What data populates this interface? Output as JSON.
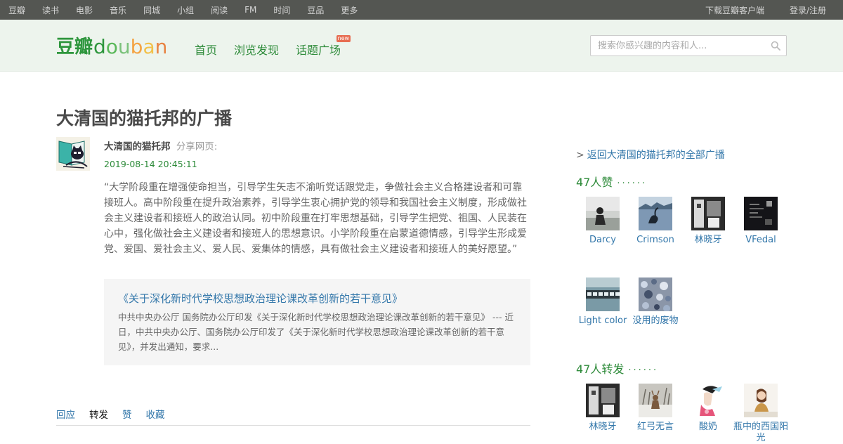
{
  "topbar": {
    "left_links": [
      "豆瓣",
      "读书",
      "电影",
      "音乐",
      "同城",
      "小组",
      "阅读",
      "FM",
      "时间",
      "豆品",
      "更多"
    ],
    "download": "下载豆瓣客户端",
    "login": "登录/注册"
  },
  "header": {
    "logo_cn": "豆瓣",
    "logo_en": "douban",
    "nav": [
      "首页",
      "浏览发现",
      "话题广场"
    ],
    "new_badge": "new",
    "search_placeholder": "搜索你感兴趣的内容和人..."
  },
  "status": {
    "page_title": "大清国的猫托邦的广播",
    "author": "大清国的猫托邦",
    "action": "分享网页:",
    "timestamp": "2019-08-14 20:45:11",
    "quote": "“大学阶段重在增强使命担当，引导学生矢志不渝听党话跟党走，争做社会主义合格建设者和可靠接班人。高中阶段重在提升政治素养，引导学生衷心拥护党的领导和我国社会主义制度，形成做社会主义建设者和接班人的政治认同。初中阶段重在打牢思想基础，引导学生把党、祖国、人民装在心中，强化做社会主义建设者和接班人的思想意识。小学阶段重在启蒙道德情感，引导学生形成爱党、爱国、爱社会主义、爱人民、爱集体的情感，具有做社会主义建设者和接班人的美好愿望。”",
    "card_title": "《关于深化新时代学校思想政治理论课改革创新的若干意见》",
    "card_desc": "中共中央办公厅 国务院办公厅印发《关于深化新时代学校思想政治理论课改革创新的若干意见》 --- 近日，中共中央办公厅、国务院办公厅印发了《关于深化新时代学校思想政治理论课改革创新的若干意见》，并发出通知，要求..."
  },
  "actions": {
    "reply": "回应",
    "reshare": "转发",
    "like": "赞",
    "collect": "收藏"
  },
  "sidebar": {
    "back_gt": ">",
    "back_link": "返回大清国的猫托邦的全部广播",
    "likes_title": "47人赞",
    "reshares_title": "47人转发",
    "dots": "······",
    "likers": [
      "Darcy",
      "Crimson",
      "林晓牙",
      "VFedal",
      "Light color",
      "没用的废物"
    ],
    "resharers": [
      "林晓牙",
      "红弓无言",
      "酸奶",
      "瓶中的西国阳光"
    ]
  },
  "colors": {
    "topbar_bg": "#545652",
    "header_bg": "#edf4ed",
    "brand_green": "#2e8b3a",
    "link_blue": "#3377aa"
  }
}
